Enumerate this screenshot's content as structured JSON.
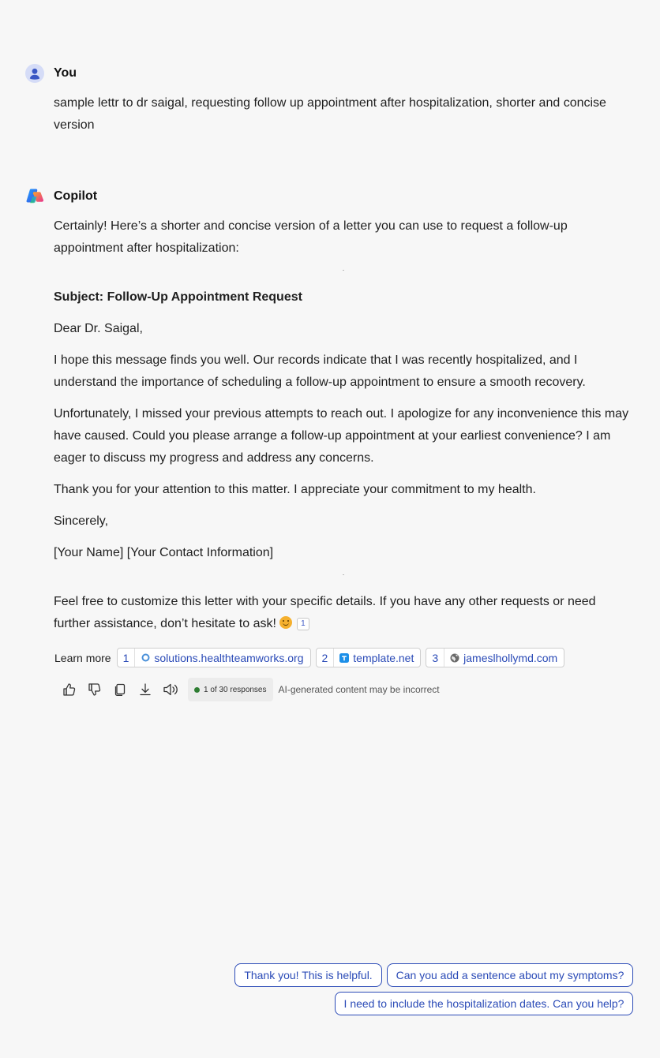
{
  "user_message": {
    "author": "You",
    "text_line1": "sample lettr to dr saigal, requesting follow up appointment after hospitalization,  shorter and concise",
    "text_line2": "version"
  },
  "copilot_message": {
    "author": "Copilot",
    "intro_line1": "Certainly! Here’s a shorter and concise version of a letter you can use to request a follow-up",
    "intro_line2": "appointment after hospitalization:",
    "subject": "Subject: Follow-Up Appointment Request",
    "salutation": "Dear Dr. Saigal,",
    "para1_line1": "I hope this message finds you well. Our records indicate that I was recently hospitalized, and I",
    "para1_line2": "understand the importance of scheduling a follow-up appointment to ensure a smooth recovery.",
    "para2_line1": "Unfortunately, I missed your previous attempts to reach out. I apologize for any inconvenience this may",
    "para2_line2": "have caused. Could you please arrange a follow-up appointment at your earliest convenience? I am",
    "para2_line3": "eager to discuss my progress and address any concerns.",
    "para3": "Thank you for your attention to this matter. I appreciate your commitment to my health.",
    "closing": "Sincerely,",
    "signature": "[Your Name] [Your Contact Information]",
    "outro_line1": "Feel free to customize this letter with your specific details. If you have any other requests or need",
    "outro_line2": "further assistance, don’t hesitate to ask!",
    "outro_citation": "1"
  },
  "learn_more": {
    "label": "Learn more",
    "sources": [
      {
        "num": "1",
        "domain": "solutions.healthteamworks.org",
        "icon": "circle-icon"
      },
      {
        "num": "2",
        "domain": "template.net",
        "icon": "t-logo-icon"
      },
      {
        "num": "3",
        "domain": "jameslhollymd.com",
        "icon": "globe-icon"
      }
    ]
  },
  "actions": {
    "response_counter": "1 of 30 responses",
    "disclaimer": "AI-generated content may be incorrect"
  },
  "suggestions": [
    "Thank you! This is helpful.",
    "Can you add a sentence about my symptoms?",
    "I need to include the hospitalization dates. Can you help?"
  ],
  "colors": {
    "background": "#f7f7f7",
    "link": "#2b4bb7",
    "status_dot": "#2e7d32"
  }
}
